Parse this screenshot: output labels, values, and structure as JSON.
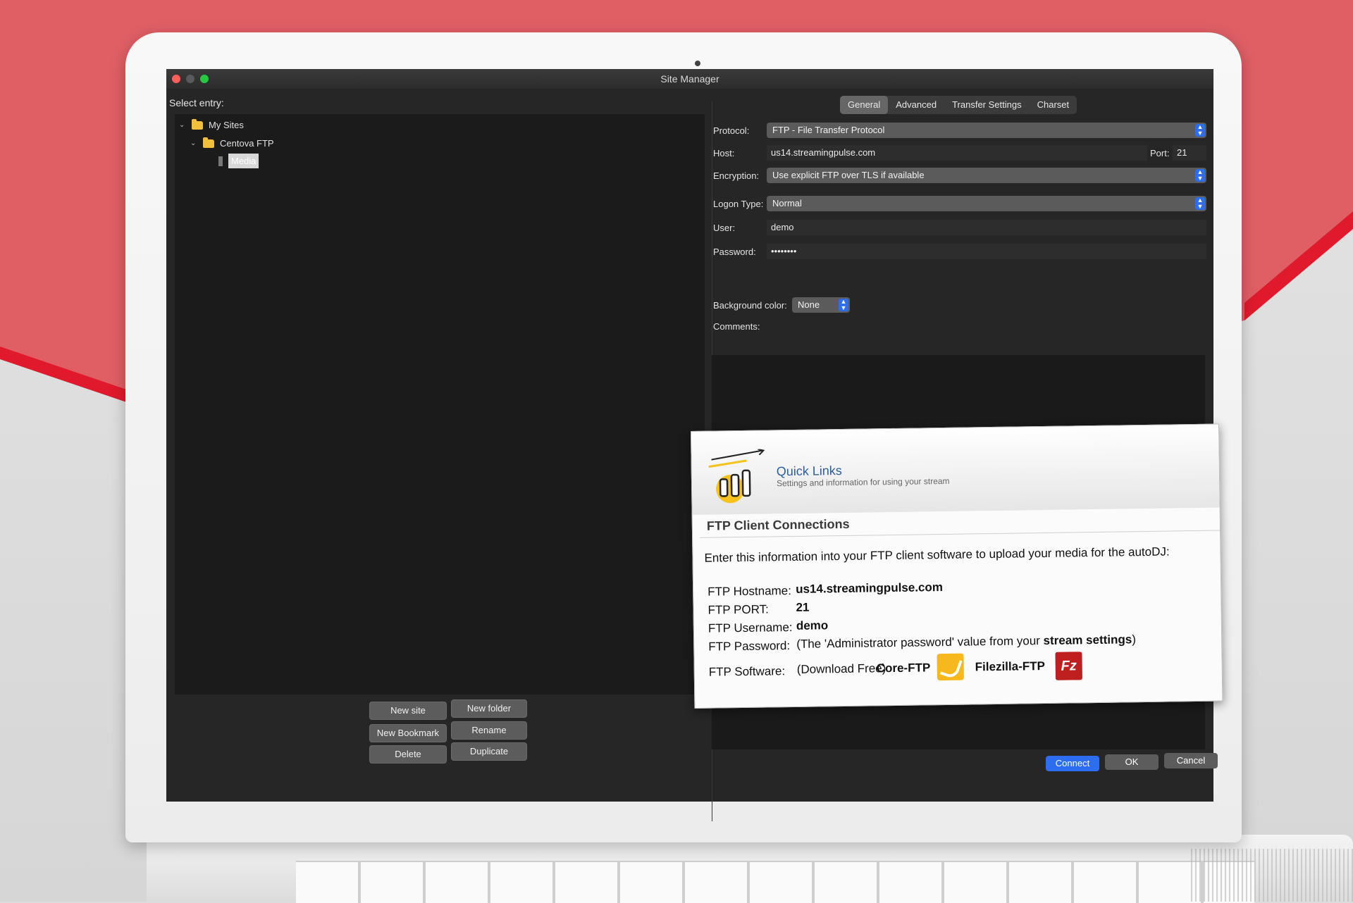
{
  "window": {
    "title": "Site Manager"
  },
  "sidebar": {
    "select_label": "Select entry:",
    "tree": [
      {
        "label": "My Sites"
      },
      {
        "label": "Centova FTP"
      },
      {
        "label": "Media"
      }
    ],
    "buttons": {
      "new_site": "New site",
      "new_folder": "New folder",
      "new_bookmark": "New Bookmark",
      "rename": "Rename",
      "delete": "Delete",
      "duplicate": "Duplicate"
    }
  },
  "tabs": [
    "General",
    "Advanced",
    "Transfer Settings",
    "Charset"
  ],
  "form": {
    "protocol": {
      "label": "Protocol:",
      "value": "FTP - File Transfer Protocol"
    },
    "host": {
      "label": "Host:",
      "value": "us14.streamingpulse.com"
    },
    "port": {
      "label": "Port:",
      "value": "21"
    },
    "encryption": {
      "label": "Encryption:",
      "value": "Use explicit FTP over TLS if available"
    },
    "logon_type": {
      "label": "Logon Type:",
      "value": "Normal"
    },
    "user": {
      "label": "User:",
      "value": "demo"
    },
    "password": {
      "label": "Password:",
      "value": "••••••••"
    },
    "background_color": {
      "label": "Background color:",
      "value": "None"
    },
    "comments": {
      "label": "Comments:"
    }
  },
  "dialog_buttons": {
    "connect": "Connect",
    "ok": "OK",
    "cancel": "Cancel"
  },
  "quick_links": {
    "title": "Quick Links",
    "subtitle": "Settings and information for using your stream",
    "section_title": "FTP Client Connections",
    "intro": "Enter this information into your FTP client software to upload your media for the autoDJ:",
    "hostname_label": "FTP Hostname:",
    "hostname_value": "us14.streamingpulse.com",
    "port_label": "FTP PORT:",
    "port_value": "21",
    "username_label": "FTP Username:",
    "username_value": "demo",
    "password_label": "FTP Password:",
    "password_text_pre": "(The 'Administrator password' value from your",
    "password_text_bold": "stream settings",
    "password_text_post": ")",
    "software_label": "FTP Software:",
    "download_text": "(Download Free)",
    "coreftp": "Core-FTP",
    "filezilla": "Filezilla-FTP",
    "fz_icon_text": "Fz"
  },
  "colors": {
    "accent_blue": "#2d6df0",
    "quick_links_title": "#2e5e9e",
    "filezilla_red": "#bf1f1f",
    "coreftp_yellow": "#f6b81c",
    "background_red": "#df5f65"
  }
}
